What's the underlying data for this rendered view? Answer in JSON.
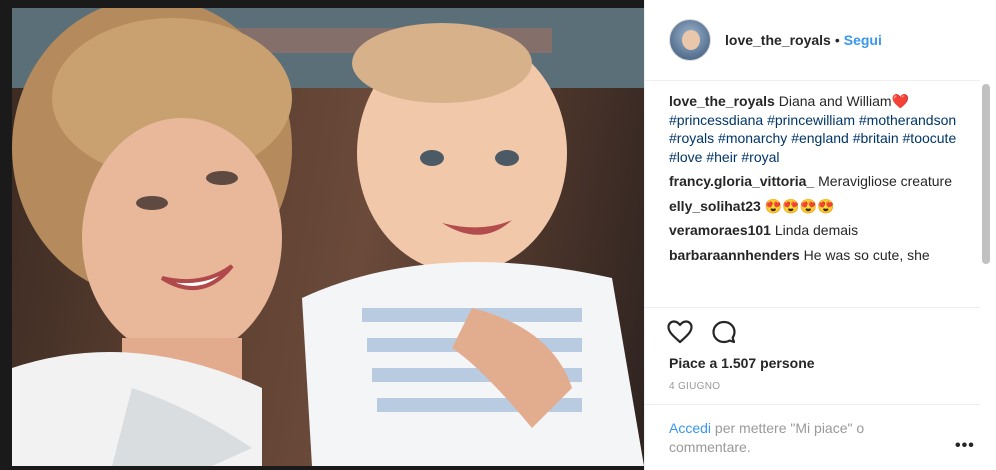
{
  "header": {
    "username": "love_the_royals",
    "separator": "•",
    "follow_label": "Segui"
  },
  "comments": [
    {
      "user": "love_the_royals",
      "text": "Diana and William",
      "emoji": "❤️",
      "hashtags": [
        "#princessdiana",
        "#princewilliam",
        "#motherandson",
        "#royals",
        "#monarchy",
        "#england",
        "#britain",
        "#toocute",
        "#love",
        "#heir",
        "#royal"
      ]
    },
    {
      "user": "francy.gloria_vittoria_",
      "text": "Meravigliose creature"
    },
    {
      "user": "elly_solihat23",
      "text": "😍😍😍😍"
    },
    {
      "user": "veramoraes101",
      "text": "Linda demais"
    },
    {
      "user": "barbaraannhenders",
      "text": "He was so cute, she"
    }
  ],
  "actions": {
    "like_icon": "heart-icon",
    "comment_icon": "comment-icon",
    "likes_text": "Piace a 1.507 persone",
    "date": "4 GIUGNO"
  },
  "login": {
    "link_label": "Accedi",
    "rest_text": "per mettere \"Mi piace\" o commentare.",
    "more_label": "•••"
  },
  "colors": {
    "link_blue": "#3897f0",
    "hashtag_blue": "#003569",
    "text": "#262626",
    "muted": "#999999"
  }
}
